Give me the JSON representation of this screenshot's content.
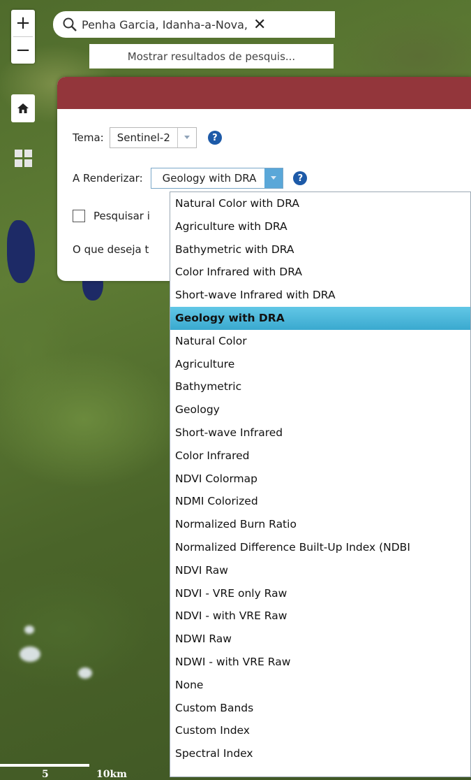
{
  "map_controls": {
    "zoom_in": "+",
    "zoom_out": "−",
    "home_icon": "home-icon",
    "apps_icon": "grid-icon"
  },
  "search": {
    "query": "Penha Garcia, Idanha-a-Nova,",
    "clear": "✕",
    "suggestion": "Mostrar resultados de pesquis..."
  },
  "panel": {
    "header_color": "#93363b",
    "tema_label": "Tema:",
    "tema_value": "Sentinel-2",
    "render_label": "A Renderizar:",
    "render_value": "Geology with DRA",
    "help": "?",
    "search_images_label": "Pesquisar i",
    "what_label": "O que deseja t"
  },
  "dropdown": {
    "selected_index": 5,
    "options": [
      "Natural Color with DRA",
      "Agriculture with DRA",
      "Bathymetric with DRA",
      "Color Infrared with DRA",
      "Short-wave Infrared with DRA",
      "Geology with DRA",
      "Natural Color",
      "Agriculture",
      "Bathymetric",
      "Geology",
      "Short-wave Infrared",
      "Color Infrared",
      "NDVI Colormap",
      "NDMI Colorized",
      "Normalized Burn Ratio",
      "Normalized Difference Built-Up Index (NDBI",
      "NDVI Raw",
      "NDVI - VRE only Raw",
      "NDVI - with VRE Raw",
      "NDWI Raw",
      "NDWI - with VRE Raw",
      "None",
      "Custom Bands",
      "Custom Index",
      "Spectral Index"
    ]
  },
  "scale": {
    "label_5": "5",
    "label_10": "10km"
  }
}
